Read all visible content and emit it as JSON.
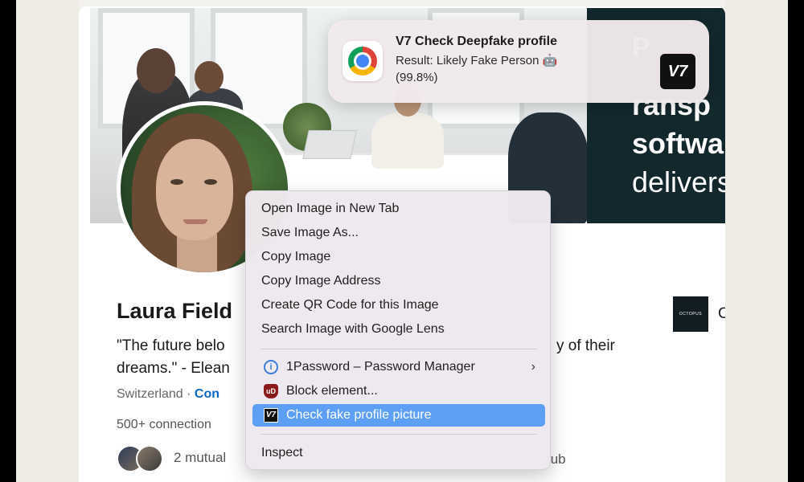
{
  "banner": {
    "ad_line0": "P",
    "ad_line1": "ransp",
    "ad_line2": "softwa",
    "ad_line3": "delivers"
  },
  "profile": {
    "name": "Laura Field",
    "quote_start": "\"The future belo",
    "quote_end": "y of their",
    "quote_line2": "dreams.\" - Elean",
    "location": "Switzerland · ",
    "contact_link": "Con",
    "connections": "500+ connection",
    "mutual": "2 mutual",
    "mutual_tail": "tub",
    "company_logo_text": "OCTOPUS",
    "company_name_start": "C"
  },
  "notification": {
    "app_icon": "chrome-icon",
    "title": "V7 Check Deepfake profile",
    "body_line1": "Result: Likely Fake Person 🤖",
    "body_line2": "(99.8%)",
    "badge": "V7"
  },
  "context_menu": {
    "items": [
      {
        "label": "Open Image in New Tab"
      },
      {
        "label": "Save Image As..."
      },
      {
        "label": "Copy Image"
      },
      {
        "label": "Copy Image Address"
      },
      {
        "label": "Create QR Code for this Image"
      },
      {
        "label": "Search Image with Google Lens"
      },
      {
        "label": "1Password – Password Manager",
        "icon": "1password-icon",
        "submenu": true
      },
      {
        "label": "Block element...",
        "icon": "ublock-icon"
      },
      {
        "label": "Check fake profile picture",
        "icon": "v7-icon",
        "highlighted": true
      },
      {
        "label": "Inspect"
      }
    ],
    "icon_1password_glyph": "i",
    "icon_ublock_glyph": "uD",
    "icon_v7_glyph": "V7",
    "submenu_chevron": "›",
    "highlight_color": "#5d9ff5"
  }
}
